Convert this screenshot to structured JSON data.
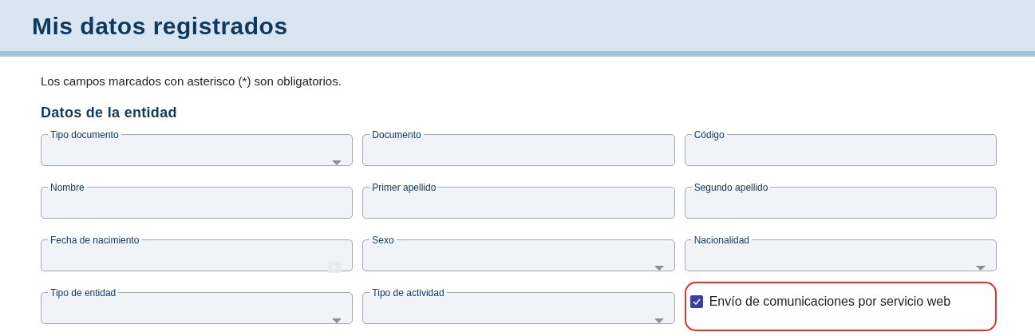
{
  "header": {
    "title": "Mis datos registrados"
  },
  "note": "Los campos marcados con asterisco (*) son obligatorios.",
  "section": {
    "title": "Datos de la entidad",
    "fields": [
      {
        "kind": "select",
        "label": "Tipo documento"
      },
      {
        "kind": "text",
        "label": "Documento"
      },
      {
        "kind": "text",
        "label": "Código"
      },
      {
        "kind": "text",
        "label": "Nombre"
      },
      {
        "kind": "text",
        "label": "Primer apellido"
      },
      {
        "kind": "text",
        "label": "Segundo apellido"
      },
      {
        "kind": "date",
        "label": "Fecha de nacimiento"
      },
      {
        "kind": "select",
        "label": "Sexo"
      },
      {
        "kind": "select",
        "label": "Nacionalidad"
      },
      {
        "kind": "select",
        "label": "Tipo de entidad"
      },
      {
        "kind": "select",
        "label": "Tipo de actividad"
      },
      {
        "kind": "checkbox",
        "label": "Envío de comunicaciones por servicio web",
        "checked": true,
        "highlighted": true
      }
    ]
  }
}
